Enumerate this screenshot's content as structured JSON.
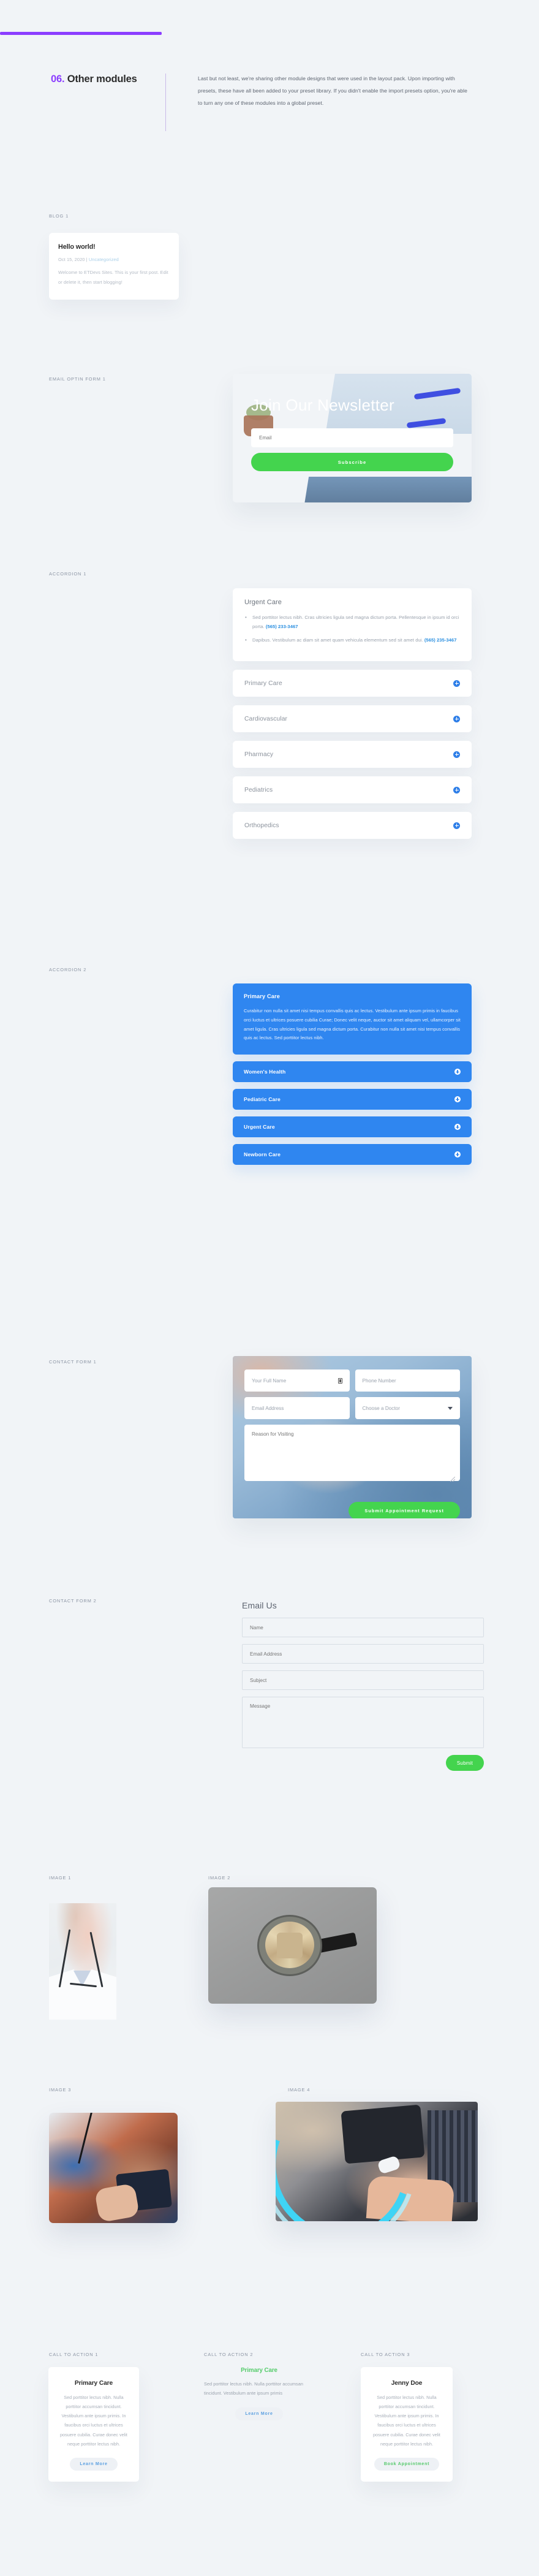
{
  "accent_colors": {
    "purple_rule": "#8b3dff",
    "blue": "#2f86f0",
    "green": "#44d44e",
    "link_blue": "#2a8fe0",
    "cta_green": "#55cc6b"
  },
  "intro": {
    "number": "06.",
    "title": "Other modules",
    "body": "Last but not least, we're sharing other module designs that were used in the layout pack. Upon importing with presets, these have all been added to your preset library. If you didn't enable the import presets option, you're able to turn any one of these modules into a global preset."
  },
  "sections": {
    "blog1": "BLOG 1",
    "email_optin1": "EMAIL OPTIN FORM 1",
    "accordion1": "ACCORDION 1",
    "accordion2": "ACCORDION 2",
    "contact_form1": "CONTACT FORM 1",
    "contact_form2": "CONTACT FORM 2",
    "image1": "IMAGE 1",
    "image2": "IMAGE 2",
    "image3": "IMAGE 3",
    "image4": "IMAGE 4",
    "cta1": "CALL TO ACTION 1",
    "cta2": "CALL TO ACTION 2",
    "cta3": "CALL TO ACTION 3"
  },
  "blog": {
    "title": "Hello world!",
    "date": "Oct 15, 2020",
    "separator": " | ",
    "category": "Uncategorized",
    "excerpt": "Welcome to ETDevs Sites. This is your first post. Edit or delete it, then start blogging!"
  },
  "optin": {
    "heading": "Join Our Newsletter",
    "email_placeholder": "Email",
    "button_label": "Subscribe"
  },
  "accordion1": {
    "open_item": {
      "title": "Urgent Care",
      "bullets": [
        {
          "text": "Sed porttitor lectus nibh. Cras ultricies ligula sed magna dictum porta. Pellentesque in ipsum id orci porta. ",
          "phone": "(565) 233-3467"
        },
        {
          "text": "Dapibus. Vestibulum ac diam sit amet quam vehicula elementum sed sit amet dui. ",
          "phone": "(565) 235-3467"
        }
      ]
    },
    "closed_items": [
      "Primary Care",
      "Cardiovascular",
      "Pharmacy",
      "Pediatrics",
      "Orthopedics"
    ]
  },
  "accordion2": {
    "open_item": {
      "title": "Primary Care",
      "body": "Curabitur non nulla sit amet nisi tempus convallis quis ac lectus. Vestibulum ante ipsum primis in faucibus orci luctus et ultrices posuere cubilia Curae; Donec velit neque, auctor sit amet aliquam vel, ullamcorper sit amet ligula. Cras ultricies ligula sed magna dictum porta. Curabitur non nulla sit amet nisi tempus convallis quis ac lectus. Sed porttitor lectus nibh."
    },
    "closed_items": [
      "Women's Health",
      "Pediatric Care",
      "Urgent Care",
      "Newborn Care"
    ]
  },
  "contact_form1": {
    "name_placeholder": "Your Full Name",
    "phone_placeholder": "Phone Number",
    "email_placeholder": "Email Address",
    "doctor_placeholder": "Choose a Doctor",
    "reason_placeholder": "Reason for Visiting",
    "submit_label": "Submit Appointment Request"
  },
  "contact_form2": {
    "heading": "Email Us",
    "name_placeholder": "Name",
    "email_placeholder": "Email Address",
    "subject_placeholder": "Subject",
    "message_placeholder": "Message",
    "submit_label": "Submit"
  },
  "cta1": {
    "title": "Primary Care",
    "body": "Sed porttitor lectus nibh. Nulla porttitor accumsan tincidunt. Vestibulum ante ipsum primis. In faucibus orci luctus et ultrices posuere cubilia. Curae donec velit neque porttitor lectus nibh.",
    "button_label": "Learn More"
  },
  "cta2": {
    "title": "Primary Care",
    "body": "Sed porttitor lectus nibh. Nulla porttitor accumsan tincidunt. Vestibulum ante ipsum primis",
    "button_label": "Learn More"
  },
  "cta3": {
    "title": "Jenny Doe",
    "body": "Sed porttitor lectus nibh. Nulla porttitor accumsan tincidunt. Vestibulum ante ipsum primis. In faucibus orci luctus et ultrices posuere cubilia. Curae donec velit neque porttitor lectus nibh.",
    "button_label": "Book Appointment"
  }
}
